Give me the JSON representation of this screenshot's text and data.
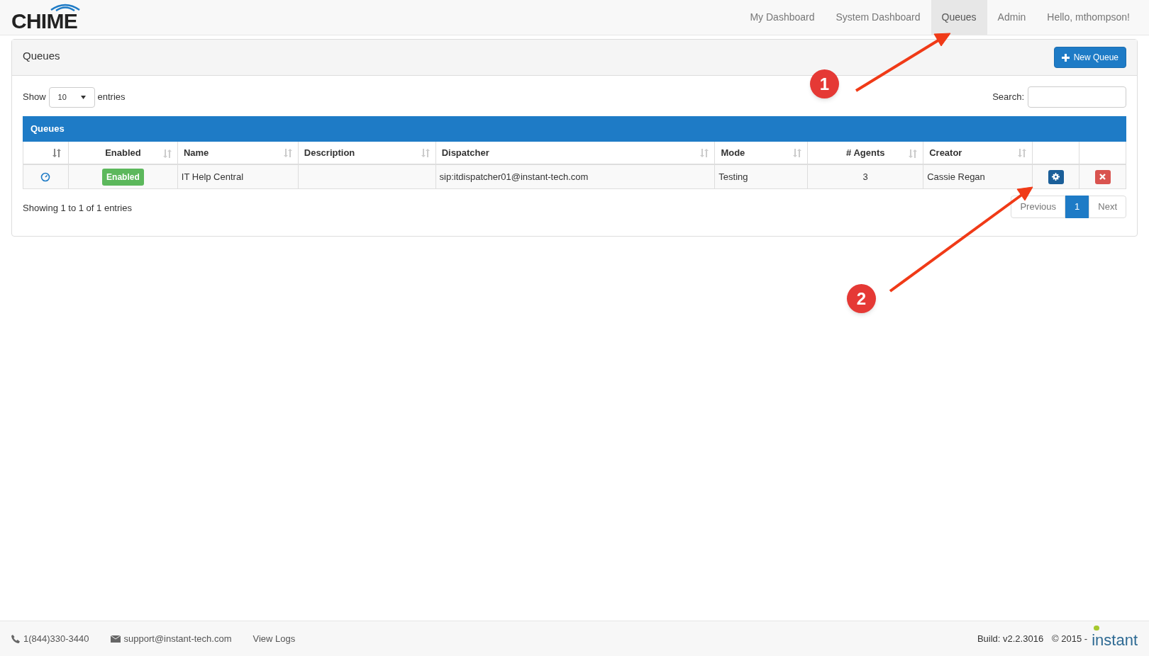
{
  "brand": {
    "logo": "CHIME"
  },
  "nav": [
    {
      "label": "My Dashboard",
      "selected": false
    },
    {
      "label": "System Dashboard",
      "selected": false
    },
    {
      "label": "Queues",
      "selected": true
    },
    {
      "label": "Admin",
      "selected": false
    },
    {
      "label": "Hello, mthompson!",
      "selected": false
    }
  ],
  "panel": {
    "title": "Queues",
    "new_button": "New Queue"
  },
  "length_control": {
    "before": "Show",
    "value": "10",
    "after": "entries"
  },
  "search": {
    "label": "Search:"
  },
  "table": {
    "caption": "Queues",
    "columns": [
      "Enabled",
      "Name",
      "Description",
      "Dispatcher",
      "Mode",
      "# Agents",
      "Creator"
    ],
    "rows": [
      {
        "enabled": "Enabled",
        "name": "IT Help Central",
        "description": "",
        "dispatcher": "sip:itdispatcher01@instant-tech.com",
        "mode": "Testing",
        "agents": "3",
        "creator": "Cassie Regan"
      }
    ]
  },
  "info": "Showing 1 to 1 of 1 entries",
  "pagination": [
    {
      "label": "Previous",
      "selected": false
    },
    {
      "label": "1",
      "selected": true
    },
    {
      "label": "Next",
      "selected": false
    }
  ],
  "annotations": [
    {
      "label": "1"
    },
    {
      "label": "2"
    }
  ],
  "footer": {
    "phone": "1(844)330-3440",
    "email": "support@instant-tech.com",
    "logs": "View Logs",
    "build": "Build: v2.2.3016",
    "copyright": "© 2015 -",
    "logo": "instant"
  }
}
